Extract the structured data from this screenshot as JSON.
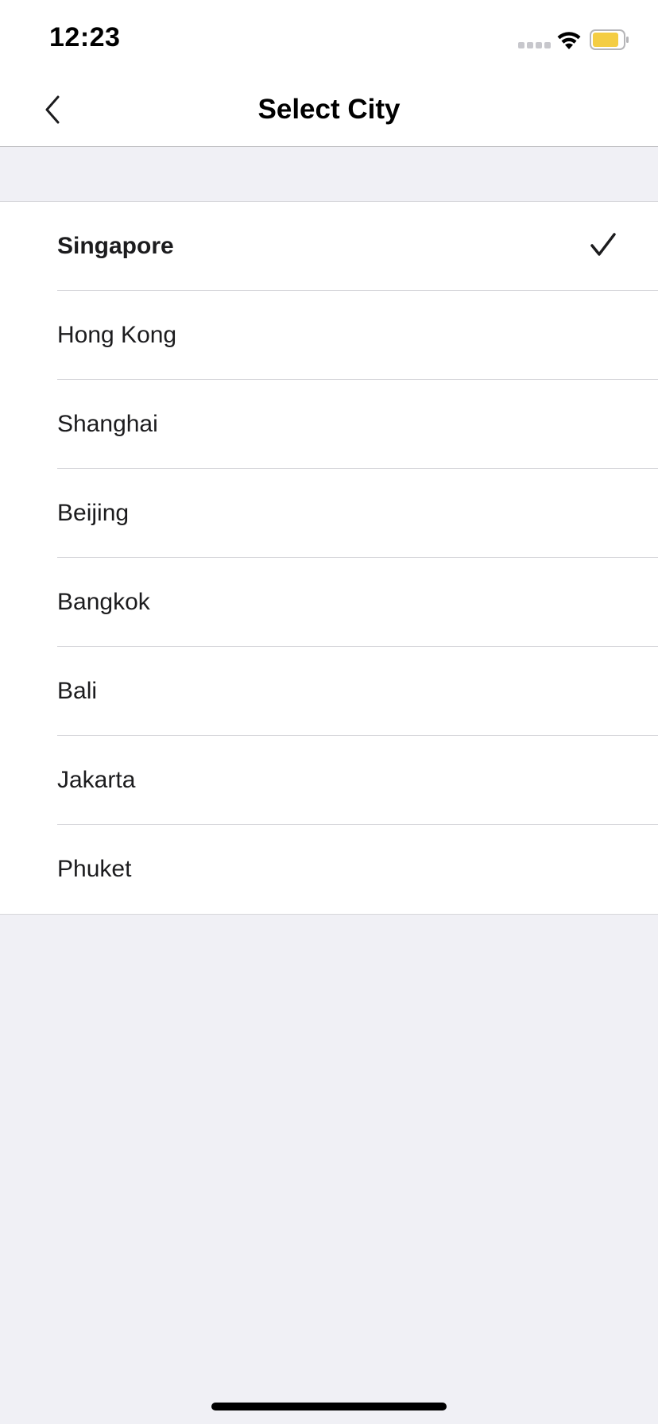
{
  "status_bar": {
    "time": "12:23",
    "battery_color": "#f4cd43"
  },
  "nav": {
    "title": "Select City"
  },
  "cities": [
    {
      "label": "Singapore",
      "selected": true
    },
    {
      "label": "Hong Kong",
      "selected": false
    },
    {
      "label": "Shanghai",
      "selected": false
    },
    {
      "label": "Beijing",
      "selected": false
    },
    {
      "label": "Bangkok",
      "selected": false
    },
    {
      "label": "Bali",
      "selected": false
    },
    {
      "label": "Jakarta",
      "selected": false
    },
    {
      "label": "Phuket",
      "selected": false
    }
  ],
  "icons": {
    "back": "chevron-left-icon",
    "selected_marker": "checkmark-icon"
  }
}
